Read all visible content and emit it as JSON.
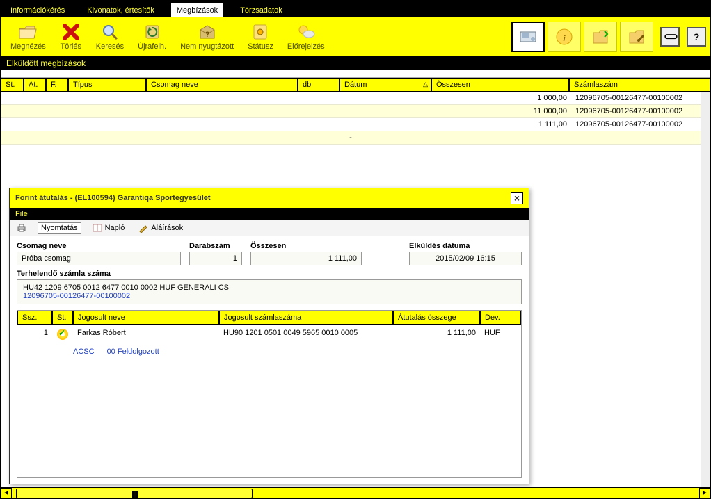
{
  "topTabs": {
    "items": [
      "Információkérés",
      "Kivonatok, értesítők",
      "Megbízások",
      "Törzsadatok"
    ],
    "activeIndex": 2
  },
  "toolbar": {
    "buttons": [
      {
        "key": "view",
        "label": "Megnézés",
        "color": "#e6b800"
      },
      {
        "key": "delete",
        "label": "Törlés",
        "color": "#cc0000"
      },
      {
        "key": "search",
        "label": "Keresés",
        "color": "#88aaff"
      },
      {
        "key": "reload",
        "label": "Újrafelh.",
        "color": "#c9a227"
      },
      {
        "key": "unack",
        "label": "Nem nyugtázott",
        "color": "#ccbb66"
      },
      {
        "key": "status",
        "label": "Státusz",
        "color": "#e6cc33"
      },
      {
        "key": "forecast",
        "label": "Előrejelzés",
        "color": "#ffe066"
      }
    ],
    "helpSymbol": "?",
    "linkSymbol": "⊖⊖"
  },
  "subtitle": "Elküldött megbízások",
  "columns": {
    "st": "St.",
    "at": "At.",
    "f": "F.",
    "tipus": "Típus",
    "csomag": "Csomag neve",
    "db": "db",
    "datum": "Dátum",
    "osszesen": "Összesen",
    "szamlaszam": "Számlaszám"
  },
  "bgRows": [
    {
      "amount": "1 000,00",
      "account": "12096705-00126477-00100002"
    },
    {
      "amount": "1 000,00",
      "account": "12096705-00126477-00100002",
      "prefix": "1"
    },
    {
      "amount": "1 111,00",
      "account": "12096705-00126477-00100002"
    }
  ],
  "bgDash": "-",
  "modal": {
    "title": "Forint átutalás  -  (EL100594)  Garantiqa Sportegyesület",
    "closeSymbol": "×",
    "menu": {
      "file": "File"
    },
    "tools": {
      "print": "Nyomtatás",
      "log": "Napló",
      "signatures": "Aláírások"
    },
    "form": {
      "csomagLabel": "Csomag neve",
      "csomagValue": "Próba csomag",
      "darabLabel": "Darabszám",
      "darabValue": "1",
      "osszLabel": "Összesen",
      "osszValue": "1 111,00",
      "elkuldLabel": "Elküldés dátuma",
      "elkuldValue": "2015/02/09 16:15",
      "terhLabel": "Terhelendő számla száma",
      "acctLine": "HU42 1209 6705 0012 6477 0010 0002    HUF  GENERALI    CS",
      "acctShort": "12096705-00126477-00100002"
    },
    "table": {
      "headers": {
        "ssz": "Ssz.",
        "st": "St.",
        "nev": "Jogosult neve",
        "szam": "Jogosult számlaszáma",
        "amt": "Átutalás összege",
        "dev": "Dev."
      },
      "row": {
        "ssz": "1",
        "nev": "Farkas Róbert",
        "szam": "HU90 1201 0501 0049 5965 0010 0005",
        "amt": "1 111,00",
        "dev": "HUF"
      },
      "statusRow": {
        "code": "ACSC",
        "text": "00 Feldolgozott"
      }
    }
  }
}
